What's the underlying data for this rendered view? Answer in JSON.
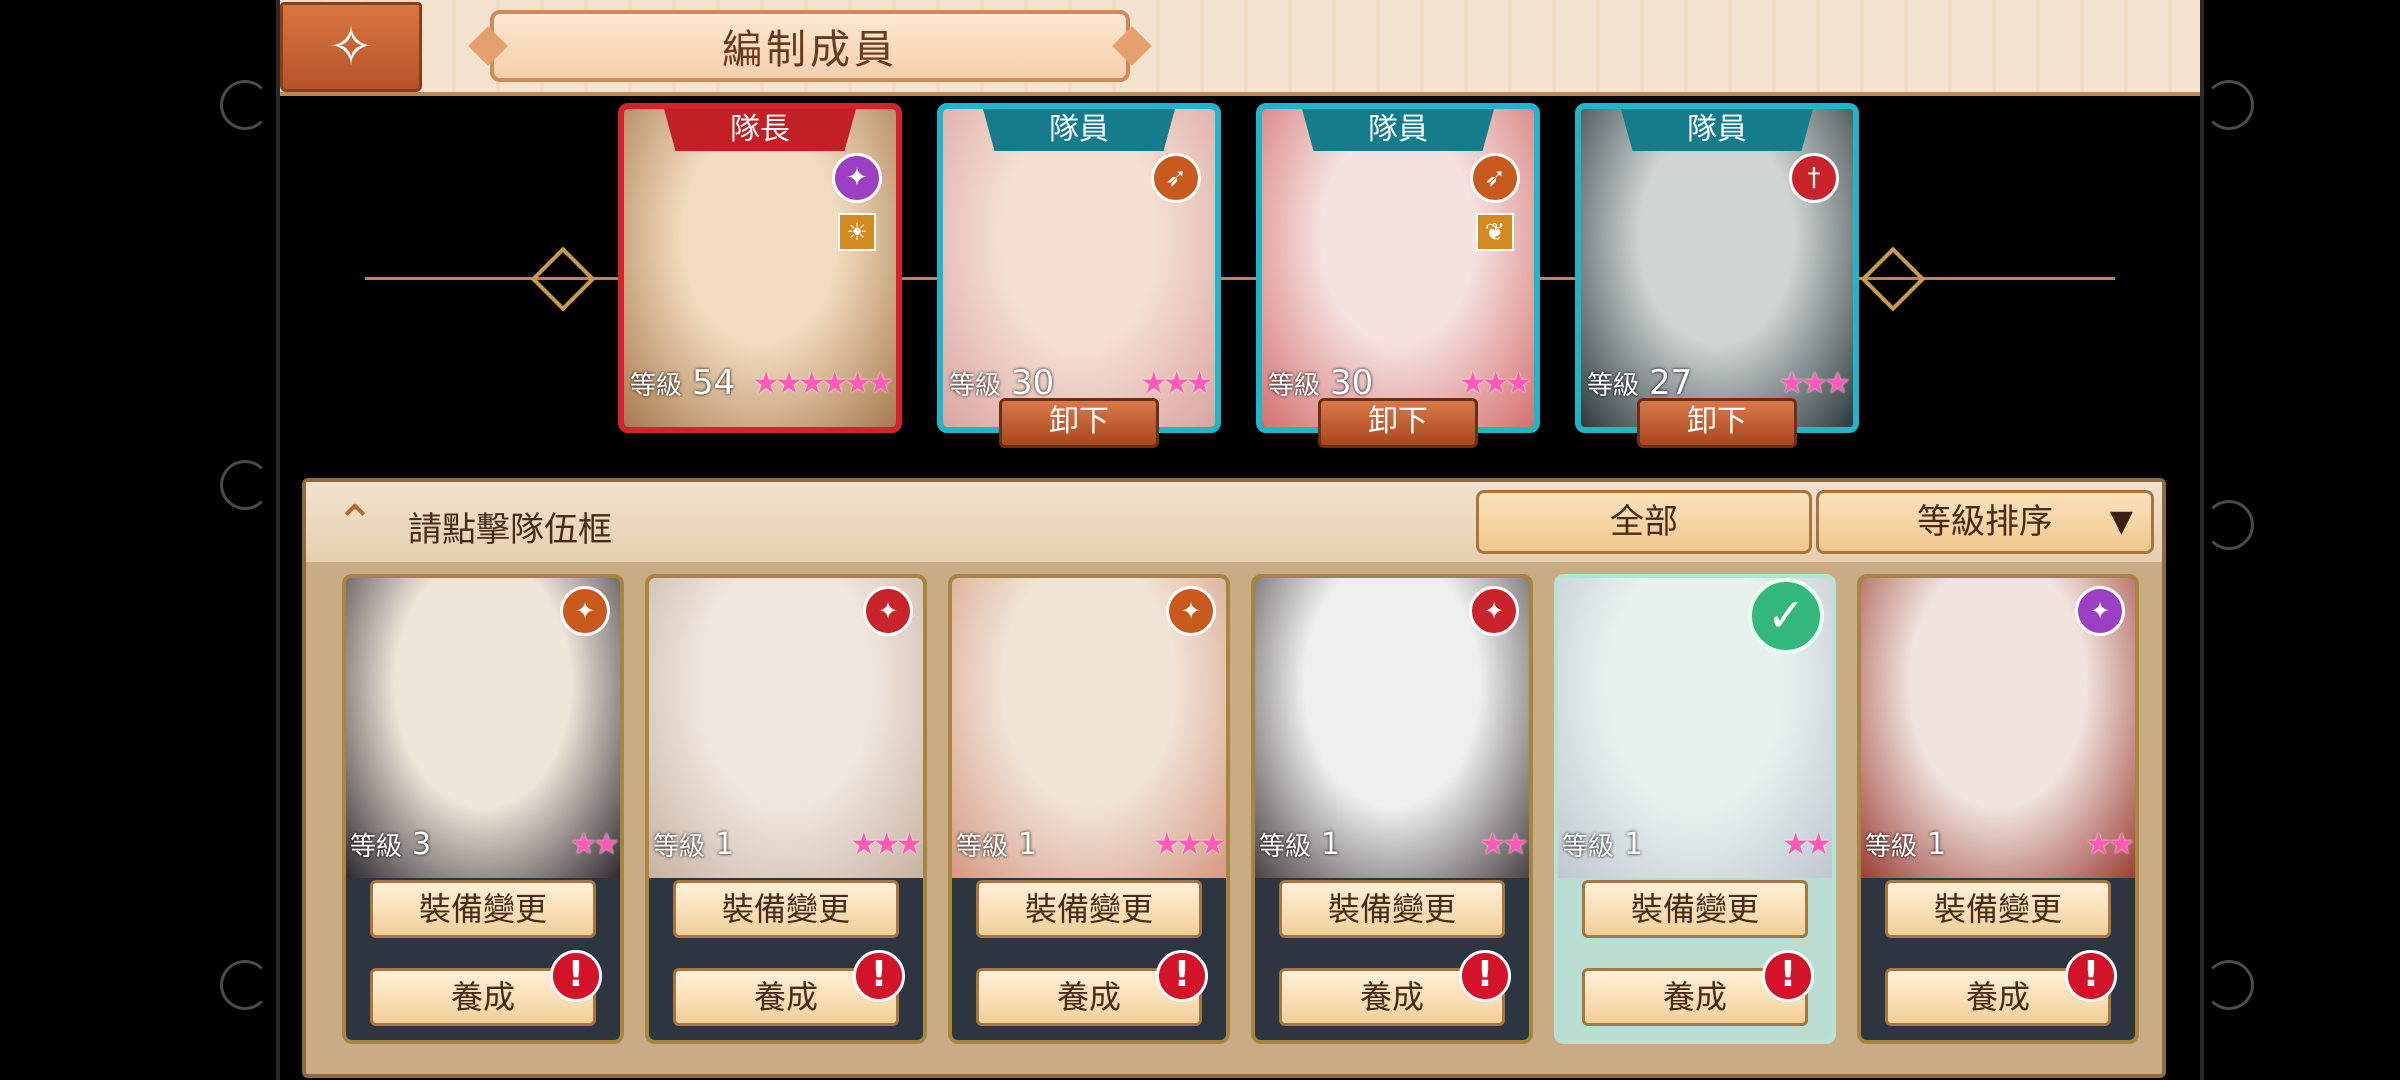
{
  "header": {
    "title": "編制成員",
    "back_icon": "ornate-back-icon"
  },
  "level_label": "等級",
  "unequip_label": "卸下",
  "party": [
    {
      "role": "隊長",
      "level": "54",
      "stars": "★★★★★★",
      "weapon": "staff",
      "weapon_color": "#9b3fc4",
      "element": "sun",
      "art": [
        "#f3dcc0",
        "#a77a4d"
      ],
      "frame_color": "#d3232b"
    },
    {
      "role": "隊員",
      "level": "30",
      "stars": "★★★",
      "weapon": "spear",
      "weapon_color": "#c85a1e",
      "element": null,
      "art": [
        "#f6e0d4",
        "#d9a5a0"
      ],
      "frame_color": "#1fb6c9"
    },
    {
      "role": "隊員",
      "level": "30",
      "stars": "★★★",
      "weapon": "spear",
      "weapon_color": "#c85a1e",
      "element": "leaf",
      "art": [
        "#f5e1e0",
        "#d4716e"
      ],
      "frame_color": "#1fb6c9"
    },
    {
      "role": "隊員",
      "level": "27",
      "stars": "★★★",
      "weapon": "sword",
      "weapon_color": "#c9232b",
      "element": null,
      "art": [
        "#cfd5d2",
        "#2d3a3d"
      ],
      "frame_color": "#1fb6c9"
    }
  ],
  "panel": {
    "hint": "請點擊隊伍框",
    "filter_all": "全部",
    "filter_sort": "等級排序",
    "equip_label": "裝備變更",
    "train_label": "養成",
    "alert_mark": "!",
    "check_mark": "✓"
  },
  "roster": [
    {
      "level": "3",
      "stars": "★★",
      "weapon_color": "#c85a1e",
      "selected": false,
      "art": [
        "#efe6da",
        "#2e2a30"
      ]
    },
    {
      "level": "1",
      "stars": "★★★",
      "weapon_color": "#c9232b",
      "selected": false,
      "art": [
        "#f0e6de",
        "#c7b2a3"
      ]
    },
    {
      "level": "1",
      "stars": "★★★",
      "weapon_color": "#c85a1e",
      "selected": false,
      "art": [
        "#f1e3d5",
        "#d59a85"
      ]
    },
    {
      "level": "1",
      "stars": "★★",
      "weapon_color": "#c9232b",
      "selected": false,
      "art": [
        "#eef0f0",
        "#4a4244"
      ]
    },
    {
      "level": "1",
      "stars": "★★",
      "weapon_color": null,
      "selected": true,
      "art": [
        "#e7f2ee",
        "#bfc7d0"
      ]
    },
    {
      "level": "1",
      "stars": "★★",
      "weapon_color": "#9b3fc4",
      "selected": false,
      "art": [
        "#f1e4df",
        "#9b3e35"
      ]
    }
  ]
}
